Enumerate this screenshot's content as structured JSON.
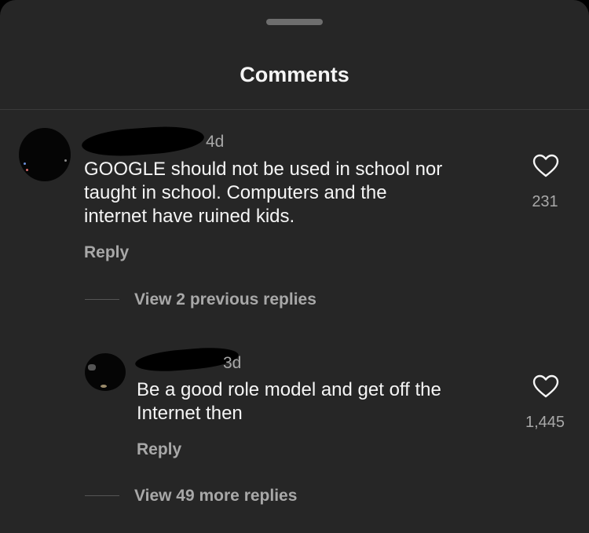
{
  "sheet": {
    "title": "Comments"
  },
  "comments": [
    {
      "time": "4d",
      "text_lines": [
        "GOOGLE should not be used in school nor",
        "taught in school.  Computers and the",
        "internet have ruined kids."
      ],
      "reply_label": "Reply",
      "like_count": "231",
      "like_icon": "heart-outline-icon"
    }
  ],
  "thread": {
    "view_previous_label": "View 2 previous replies",
    "reply": {
      "time": "3d",
      "text_lines": [
        "Be a good role model and get off the",
        "Internet then"
      ],
      "reply_label": "Reply",
      "like_count": "1,445",
      "like_icon": "heart-outline-icon"
    },
    "view_more_label": "View 49 more replies"
  },
  "colors": {
    "background": "#262626",
    "primary_text": "#f5f5f5",
    "secondary_text": "#a8a8a8"
  }
}
